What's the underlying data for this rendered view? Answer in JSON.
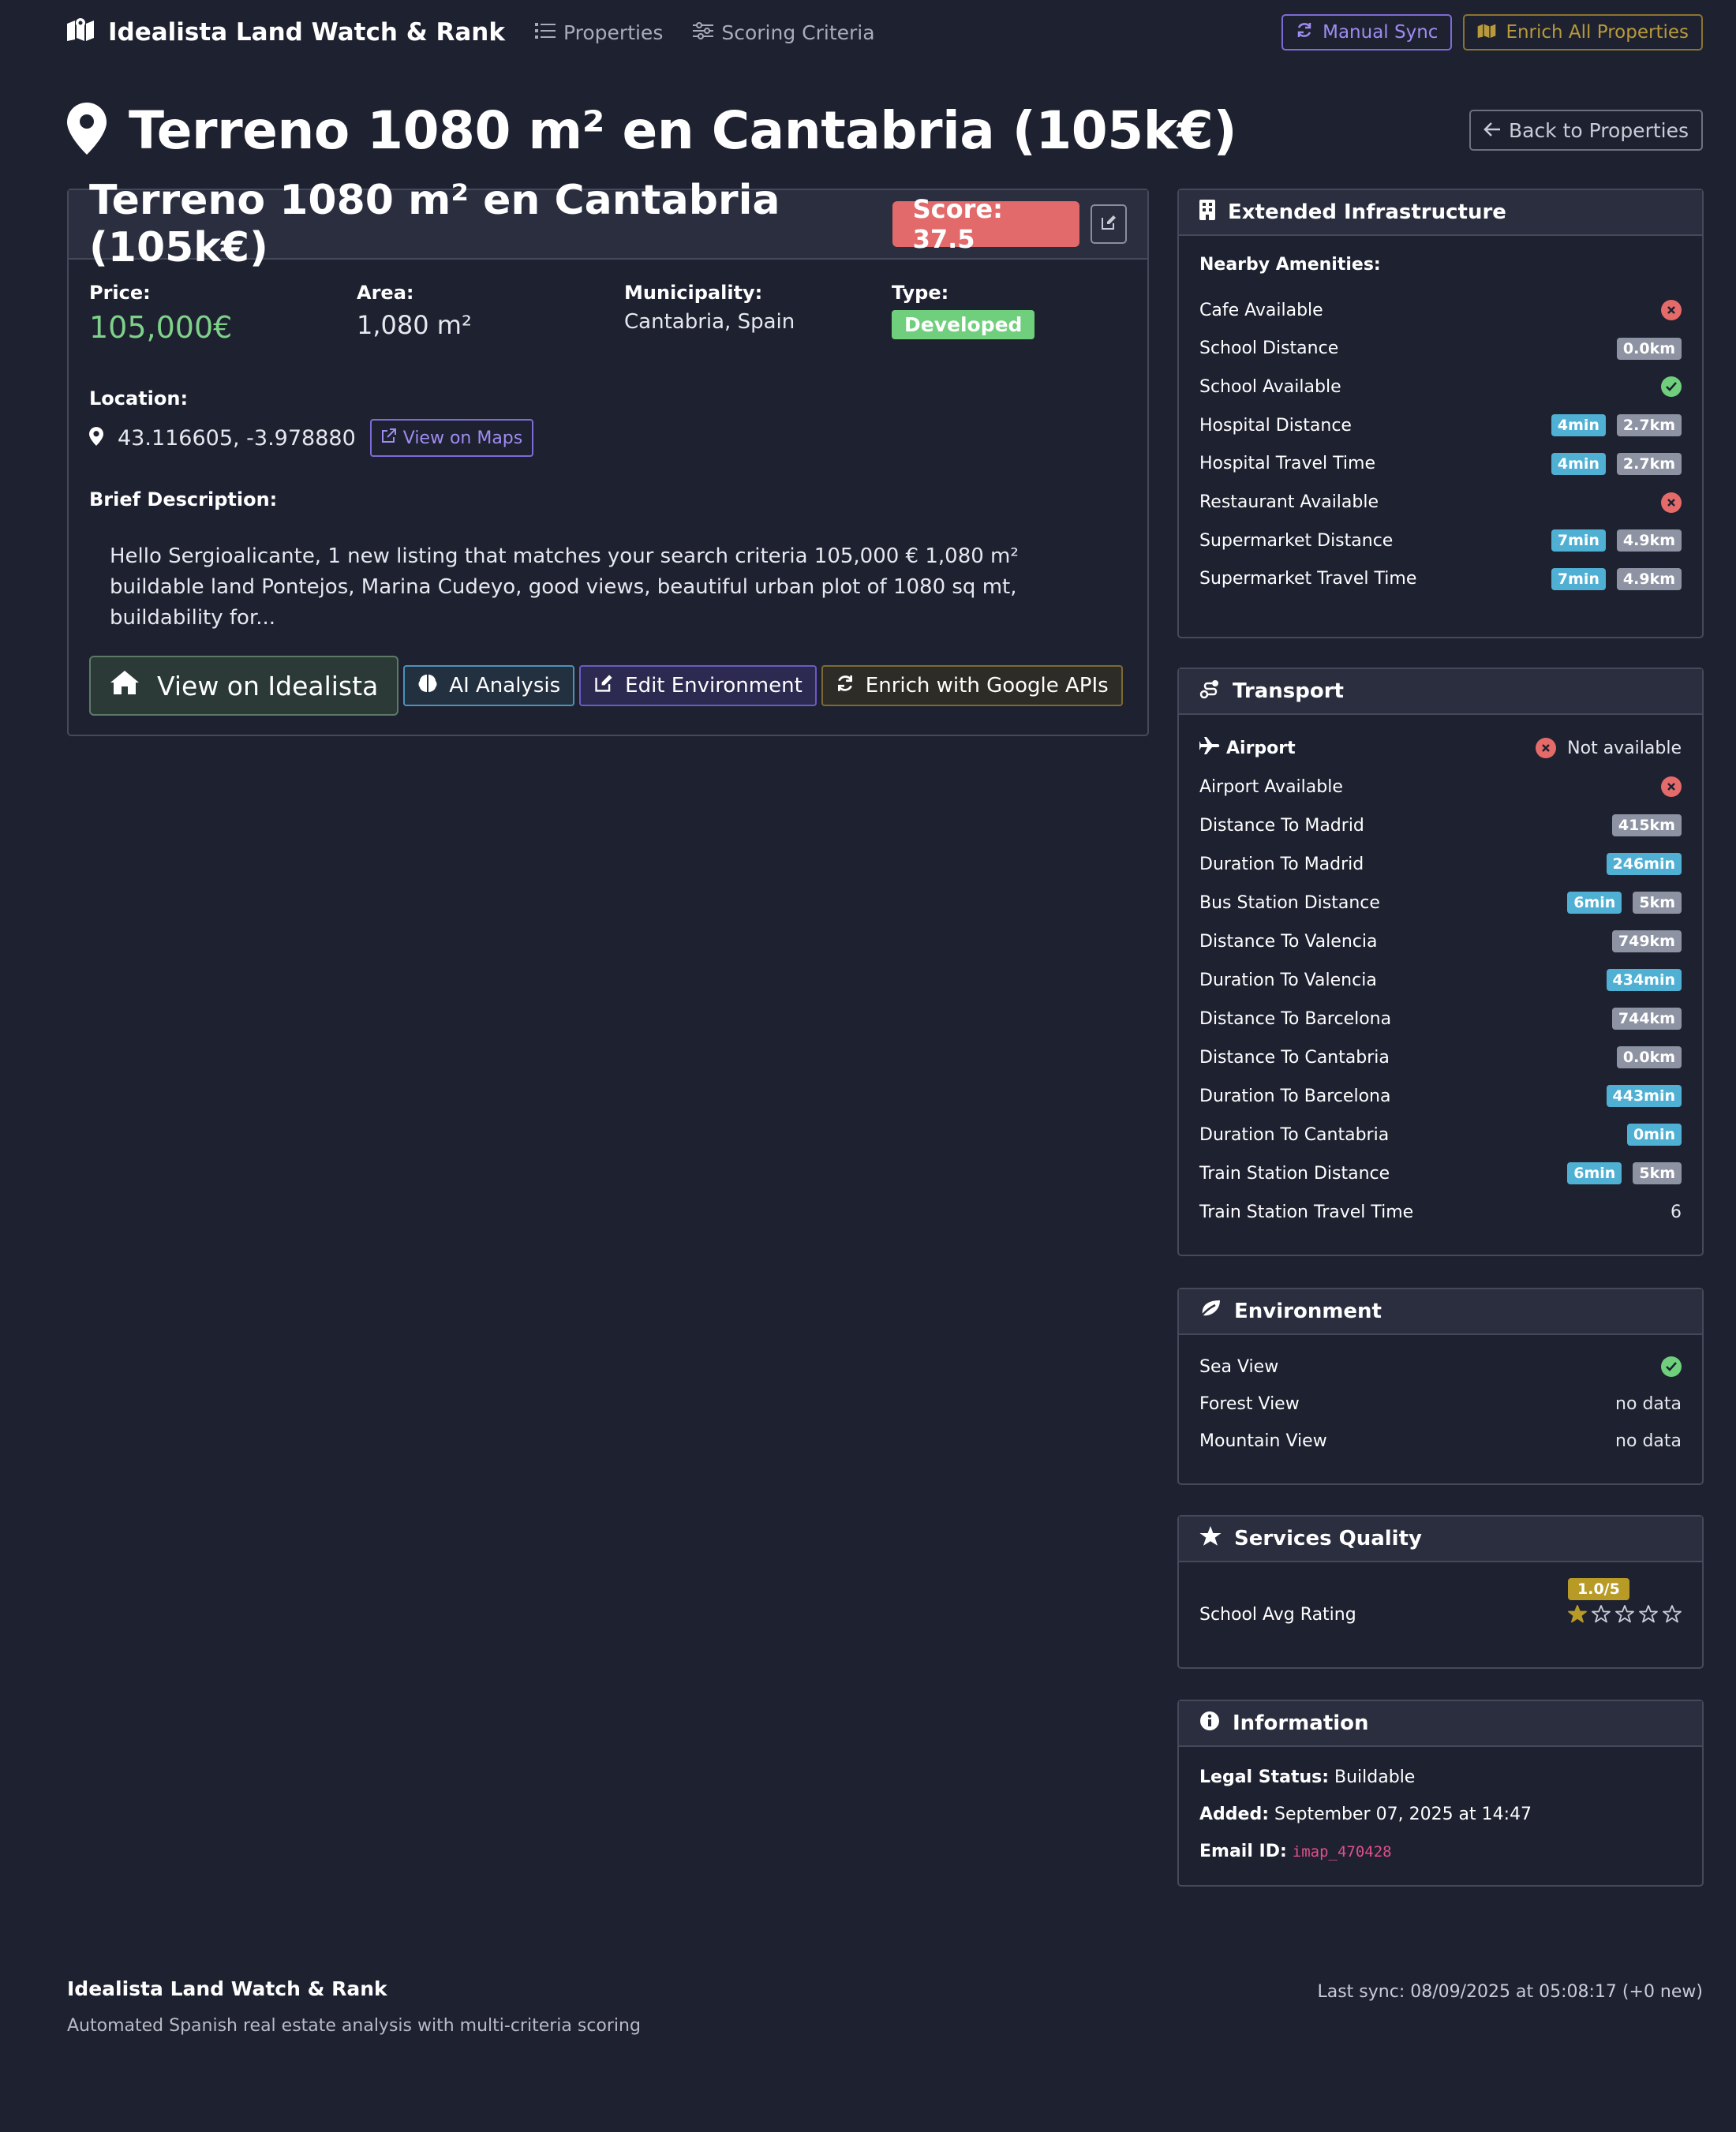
{
  "nav": {
    "brand": "Idealista Land Watch & Rank",
    "links": [
      "Properties",
      "Scoring Criteria"
    ],
    "manual_sync": "Manual Sync",
    "enrich_all": "Enrich All Properties"
  },
  "header": {
    "title": "Terreno 1080 m² en Cantabria (105k€)",
    "back": "Back to Properties"
  },
  "property": {
    "title": "Terreno 1080 m² en Cantabria (105k€)",
    "score": "Score: 37.5",
    "price_label": "Price:",
    "price": "105,000€",
    "area_label": "Area:",
    "area": "1,080 m²",
    "municipality_label": "Municipality:",
    "municipality": "Cantabria, Spain",
    "type_label": "Type:",
    "type": "Developed",
    "location_label": "Location:",
    "coords": "43.116605, -3.978880",
    "view_maps": "View on Maps",
    "desc_label": "Brief Description:",
    "description": "Hello Sergioalicante, 1 new listing that matches your search criteria 105,000 € 1,080 m² buildable land Pontejos, Marina Cudeyo, good views, beautiful urban plot of 1080 sq mt, buildability for...",
    "actions": {
      "idealista": "View on Idealista",
      "ai": "AI Analysis",
      "edit_env": "Edit Environment",
      "google": "Enrich with Google APIs"
    }
  },
  "infrastructure": {
    "title": "Extended Infrastructure",
    "subtitle": "Nearby Amenities:",
    "rows": [
      {
        "label": "Cafe Available",
        "status": "no"
      },
      {
        "label": "School Distance",
        "pills": [
          "0.0km"
        ]
      },
      {
        "label": "School Available",
        "status": "yes"
      },
      {
        "label": "Hospital Distance",
        "pills": [
          "4min",
          "2.7km"
        ]
      },
      {
        "label": "Hospital Travel Time",
        "pills": [
          "4min",
          "2.7km"
        ]
      },
      {
        "label": "Restaurant Available",
        "status": "no"
      },
      {
        "label": "Supermarket Distance",
        "pills": [
          "7min",
          "4.9km"
        ]
      },
      {
        "label": "Supermarket Travel Time",
        "pills": [
          "7min",
          "4.9km"
        ]
      }
    ]
  },
  "transport": {
    "title": "Transport",
    "airport_label": "Airport",
    "airport_status": "Not available",
    "rows": [
      {
        "label": "Airport Available",
        "status": "no"
      },
      {
        "label": "Distance To Madrid",
        "pills": [
          "415km"
        ]
      },
      {
        "label": "Duration To Madrid",
        "pills": [
          "246min"
        ]
      },
      {
        "label": "Bus Station Distance",
        "pills": [
          "6min",
          "5km"
        ]
      },
      {
        "label": "Distance To Valencia",
        "pills": [
          "749km"
        ]
      },
      {
        "label": "Duration To Valencia",
        "pills": [
          "434min"
        ]
      },
      {
        "label": "Distance To Barcelona",
        "pills": [
          "744km"
        ]
      },
      {
        "label": "Distance To Cantabria",
        "pills": [
          "0.0km"
        ]
      },
      {
        "label": "Duration To Barcelona",
        "pills": [
          "443min"
        ]
      },
      {
        "label": "Duration To Cantabria",
        "pills": [
          "0min"
        ]
      },
      {
        "label": "Train Station Distance",
        "pills": [
          "6min",
          "5km"
        ]
      },
      {
        "label": "Train Station Travel Time",
        "text": "6"
      }
    ]
  },
  "environment": {
    "title": "Environment",
    "rows": [
      {
        "label": "Sea View",
        "status": "yes"
      },
      {
        "label": "Forest View",
        "text": "no data"
      },
      {
        "label": "Mountain View",
        "text": "no data"
      }
    ]
  },
  "services": {
    "title": "Services Quality",
    "school_label": "School Avg Rating",
    "rating": "1.0/5",
    "stars_filled": 1,
    "stars_total": 5
  },
  "information": {
    "title": "Information",
    "legal_label": "Legal Status:",
    "legal": "Buildable",
    "added_label": "Added:",
    "added": "September 07, 2025 at 14:47",
    "email_label": "Email ID:",
    "email": "imap_470428"
  },
  "footer": {
    "title": "Idealista Land Watch & Rank",
    "subtitle": "Automated Spanish real estate analysis with multi-criteria scoring",
    "sync": "Last sync: 08/09/2025 at 05:08:17 (+0 new)"
  },
  "colors": {
    "background": "#1e2130",
    "price": "#7fd18a",
    "score": "#e36a6a",
    "pill_gray": "#8d93a2",
    "pill_blue": "#4fb0d4",
    "yes": "#6fcf7c",
    "no": "#e56a6a",
    "star": "#b89a26"
  }
}
